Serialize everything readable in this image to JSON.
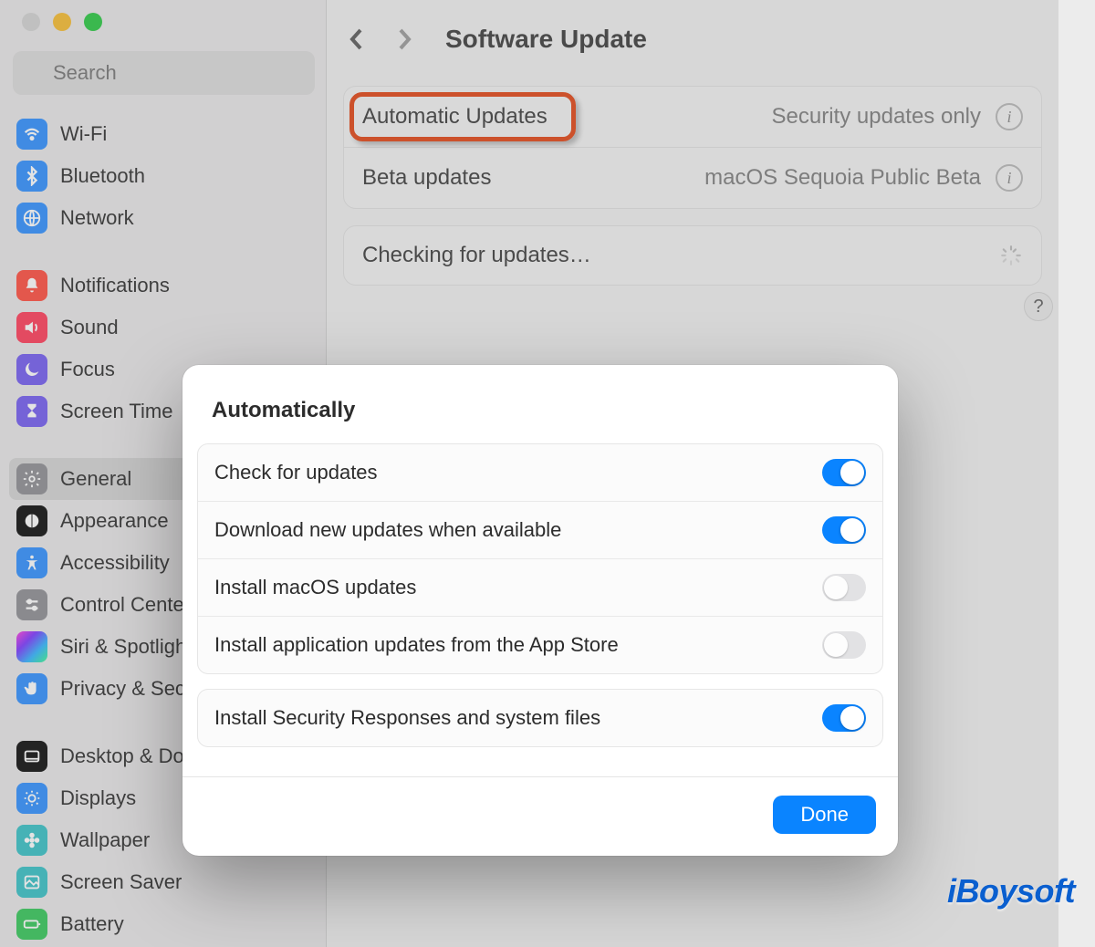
{
  "search": {
    "placeholder": "Search"
  },
  "sidebar": {
    "items": [
      {
        "label": "Wi-Fi"
      },
      {
        "label": "Bluetooth"
      },
      {
        "label": "Network"
      },
      {
        "label": "Notifications"
      },
      {
        "label": "Sound"
      },
      {
        "label": "Focus"
      },
      {
        "label": "Screen Time"
      },
      {
        "label": "General"
      },
      {
        "label": "Appearance"
      },
      {
        "label": "Accessibility"
      },
      {
        "label": "Control Center"
      },
      {
        "label": "Siri & Spotlight"
      },
      {
        "label": "Privacy & Security"
      },
      {
        "label": "Desktop & Dock"
      },
      {
        "label": "Displays"
      },
      {
        "label": "Wallpaper"
      },
      {
        "label": "Screen Saver"
      },
      {
        "label": "Battery"
      }
    ]
  },
  "header": {
    "title": "Software Update"
  },
  "panel": {
    "rows": [
      {
        "label": "Automatic Updates",
        "value": "Security updates only"
      },
      {
        "label": "Beta updates",
        "value": "macOS Sequoia Public Beta"
      }
    ],
    "checking": "Checking for updates…"
  },
  "sheet": {
    "title": "Automatically",
    "group1": [
      {
        "label": "Check for updates",
        "on": true
      },
      {
        "label": "Download new updates when available",
        "on": true
      },
      {
        "label": "Install macOS updates",
        "on": false
      },
      {
        "label": "Install application updates from the App Store",
        "on": false
      }
    ],
    "group2": [
      {
        "label": "Install Security Responses and system files",
        "on": true
      }
    ],
    "done": "Done"
  },
  "watermark": "iBoysoft"
}
